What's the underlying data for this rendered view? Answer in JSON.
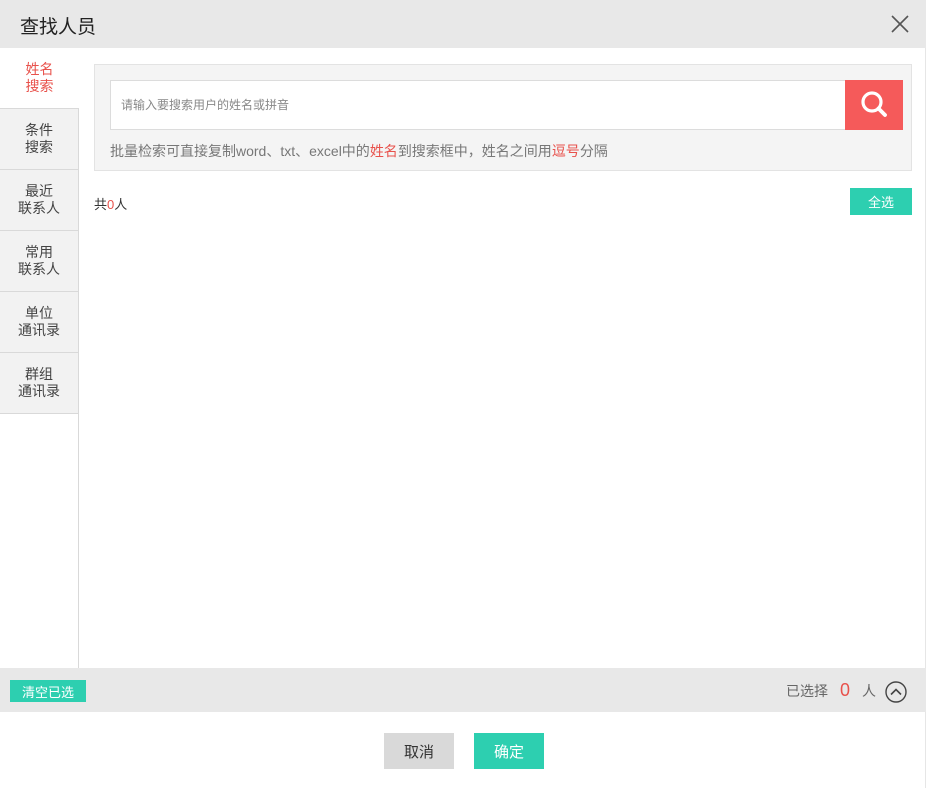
{
  "dialog": {
    "title": "查找人员",
    "close_icon": "close-icon"
  },
  "sidebar": {
    "items": [
      {
        "line1": "姓名",
        "line2": "搜索",
        "active": true
      },
      {
        "line1": "条件",
        "line2": "搜索",
        "active": false
      },
      {
        "line1": "最近",
        "line2": "联系人",
        "active": false
      },
      {
        "line1": "常用",
        "line2": "联系人",
        "active": false
      },
      {
        "line1": "单位",
        "line2": "通讯录",
        "active": false
      },
      {
        "line1": "群组",
        "line2": "通讯录",
        "active": false
      }
    ]
  },
  "search": {
    "placeholder": "请输入要搜索用户的姓名或拼音",
    "value": "",
    "button_icon": "search-icon",
    "hint_part1": "批量检索可直接复制word、txt、excel中的",
    "hint_red1": "姓名",
    "hint_part2": "到搜索框中，姓名之间用",
    "hint_red2": "逗号",
    "hint_part3": "分隔"
  },
  "results": {
    "prefix": "共",
    "count": "0",
    "suffix": "人",
    "select_all_label": "全选"
  },
  "footer": {
    "clear_label": "清空已选",
    "selected_prefix": "已选择",
    "selected_count": "0",
    "selected_suffix": "人",
    "toggle_icon": "chevron-up-circle-icon"
  },
  "actions": {
    "cancel_label": "取消",
    "ok_label": "确定"
  },
  "colors": {
    "accent": "#2dcfb0",
    "danger": "#f55a5a",
    "highlight_text": "#e8514b",
    "header_bg": "#e8e8e8"
  }
}
